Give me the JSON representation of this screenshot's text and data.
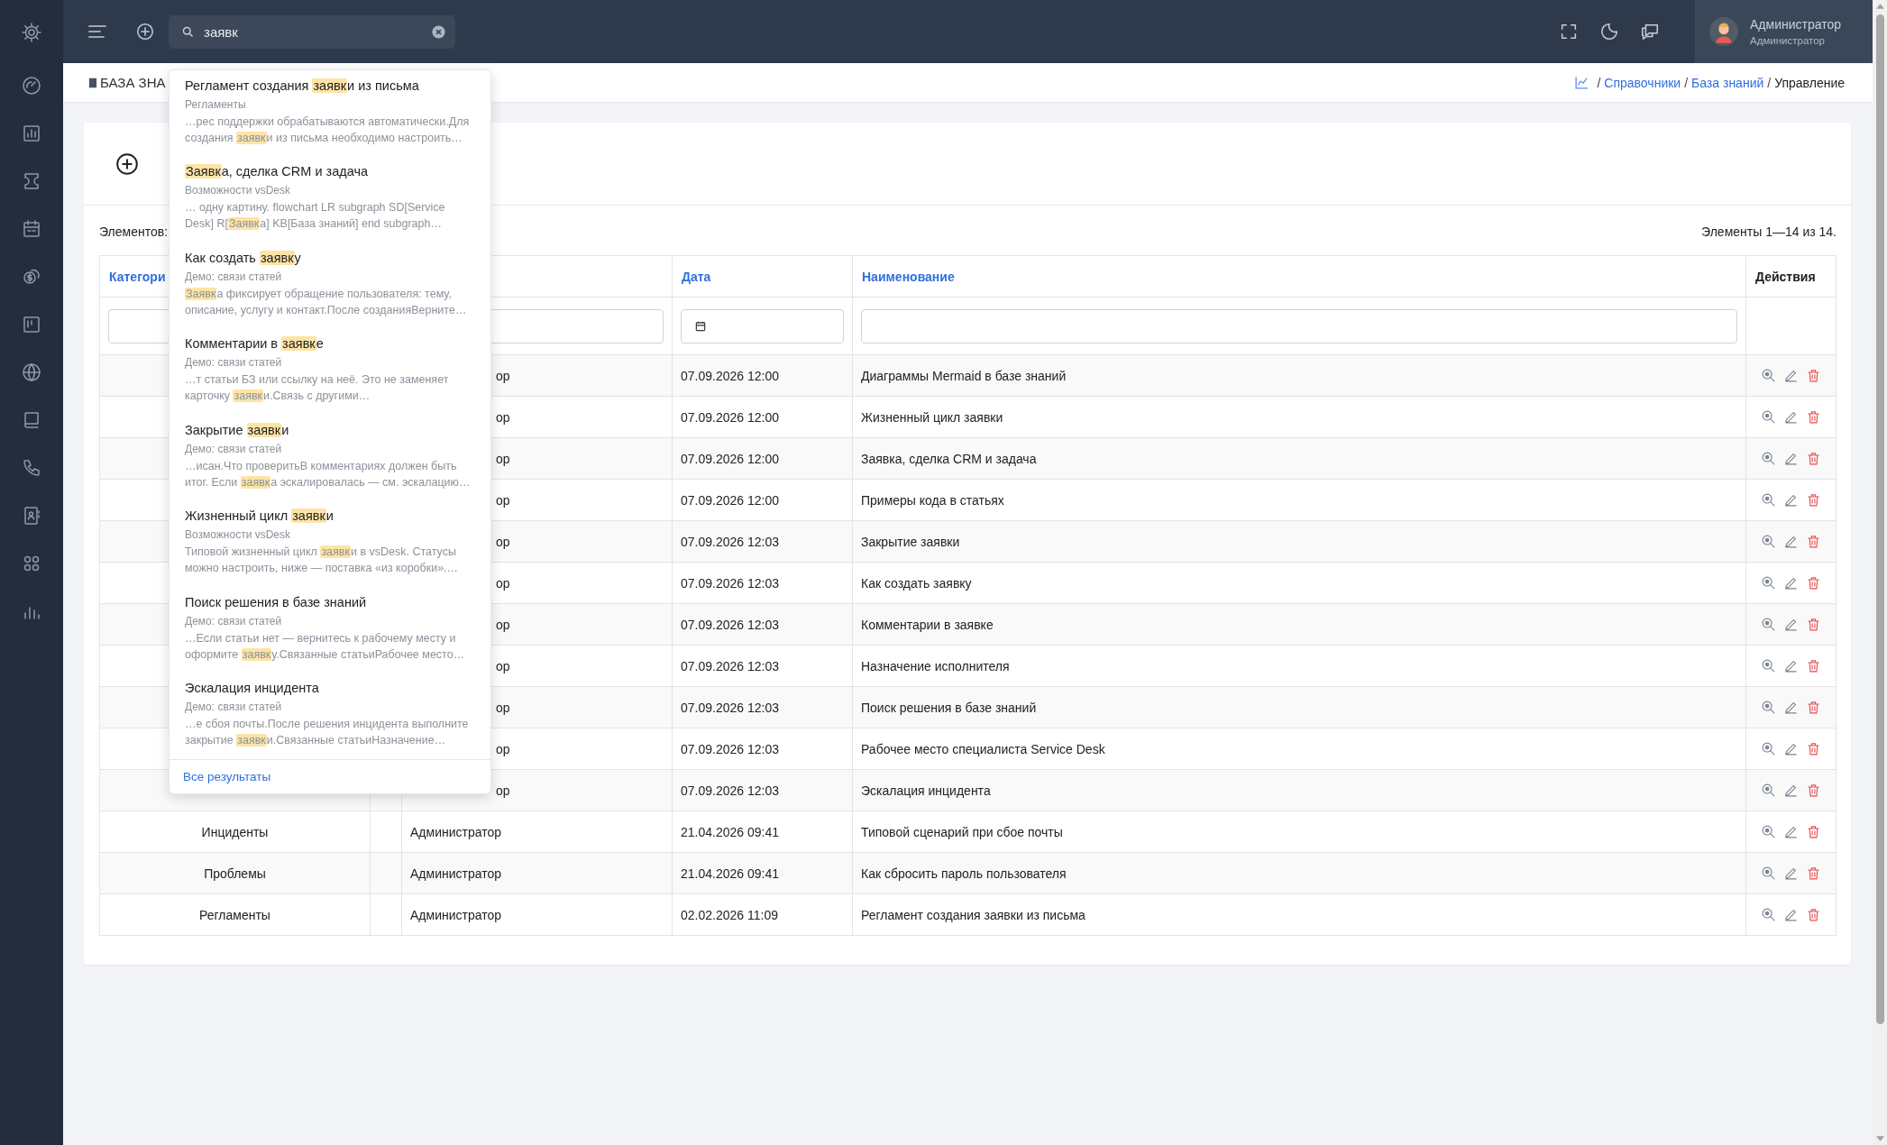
{
  "search": {
    "value": "заявк",
    "results": [
      {
        "title": [
          {
            "text": "Регламент создания ",
            "highlighted": false
          },
          {
            "text": "заявк",
            "highlighted": true
          },
          {
            "text": "и из письма",
            "highlighted": false
          }
        ],
        "category": "Регламенты",
        "snippet": [
          [
            {
              "text": "…рес поддержки обрабатываются автоматически.Для",
              "highlighted": false
            }
          ],
          [
            {
              "text": "создания ",
              "highlighted": false
            },
            {
              "text": "заявк",
              "highlighted": true
            },
            {
              "text": "и из письма необходимо настроить…",
              "highlighted": false
            }
          ]
        ]
      },
      {
        "title": [
          {
            "text": "Заявк",
            "highlighted": true
          },
          {
            "text": "а, сделка CRM и задача",
            "highlighted": false
          }
        ],
        "category": "Возможности vsDesk",
        "snippet": [
          [
            {
              "text": "… одну картину. flowchart LR subgraph SD[Service",
              "highlighted": false
            }
          ],
          [
            {
              "text": "Desk] R[",
              "highlighted": false
            },
            {
              "text": "Заявк",
              "highlighted": true
            },
            {
              "text": "а] KB[База знаний] end subgraph…",
              "highlighted": false
            }
          ]
        ]
      },
      {
        "title": [
          {
            "text": "Как создать ",
            "highlighted": false
          },
          {
            "text": "заявк",
            "highlighted": true
          },
          {
            "text": "у",
            "highlighted": false
          }
        ],
        "category": "Демо: связи статей",
        "snippet": [
          [
            {
              "text": "Заявк",
              "highlighted": true
            },
            {
              "text": "а фиксирует обращение пользователя: тему,",
              "highlighted": false
            }
          ],
          [
            {
              "text": "описание, услугу и контакт.После созданияВерните…",
              "highlighted": false
            }
          ]
        ]
      },
      {
        "title": [
          {
            "text": "Комментарии в ",
            "highlighted": false
          },
          {
            "text": "заявк",
            "highlighted": true
          },
          {
            "text": "е",
            "highlighted": false
          }
        ],
        "category": "Демо: связи статей",
        "snippet": [
          [
            {
              "text": "…т статьи БЗ или ссылку на неё. Это не заменяет",
              "highlighted": false
            }
          ],
          [
            {
              "text": "карточку ",
              "highlighted": false
            },
            {
              "text": "заявк",
              "highlighted": true
            },
            {
              "text": "и.Связь с другими…",
              "highlighted": false
            }
          ]
        ]
      },
      {
        "title": [
          {
            "text": "Закрытие ",
            "highlighted": false
          },
          {
            "text": "заявк",
            "highlighted": true
          },
          {
            "text": "и",
            "highlighted": false
          }
        ],
        "category": "Демо: связи статей",
        "snippet": [
          [
            {
              "text": "…исан.Что проверитьВ комментариях должен быть",
              "highlighted": false
            }
          ],
          [
            {
              "text": "итог. Если ",
              "highlighted": false
            },
            {
              "text": "заявк",
              "highlighted": true
            },
            {
              "text": "а эскалировалась — см. эскалацию…",
              "highlighted": false
            }
          ]
        ]
      },
      {
        "title": [
          {
            "text": "Жизненный цикл ",
            "highlighted": false
          },
          {
            "text": "заявк",
            "highlighted": true
          },
          {
            "text": "и",
            "highlighted": false
          }
        ],
        "category": "Возможности vsDesk",
        "snippet": [
          [
            {
              "text": "Типовой жизненный цикл ",
              "highlighted": false
            },
            {
              "text": "заявк",
              "highlighted": true
            },
            {
              "text": "и в vsDesk. Статусы",
              "highlighted": false
            }
          ],
          [
            {
              "text": "можно настроить, ниже — поставка «из коробки».…",
              "highlighted": false
            }
          ]
        ]
      },
      {
        "title": [
          {
            "text": "Поиск решения в базе знаний",
            "highlighted": false
          }
        ],
        "category": "Демо: связи статей",
        "snippet": [
          [
            {
              "text": "…Если статьи нет — вернитесь к рабочему месту и",
              "highlighted": false
            }
          ],
          [
            {
              "text": "оформите ",
              "highlighted": false
            },
            {
              "text": "заявк",
              "highlighted": true
            },
            {
              "text": "у.Связанные статьиРабочее место…",
              "highlighted": false
            }
          ]
        ]
      },
      {
        "title": [
          {
            "text": "Эскалация инцидента",
            "highlighted": false
          }
        ],
        "category": "Демо: связи статей",
        "snippet": [
          [
            {
              "text": "…е сбоя почты.После решения инцидента выполните",
              "highlighted": false
            }
          ],
          [
            {
              "text": "закрытие ",
              "highlighted": false
            },
            {
              "text": "заявк",
              "highlighted": true
            },
            {
              "text": "и.Связанные статьиНазначение…",
              "highlighted": false
            }
          ]
        ]
      }
    ],
    "all_results": "Все результаты"
  },
  "user": {
    "name": "Администратор",
    "role": "Администратор"
  },
  "page_title": "БАЗА ЗНА",
  "breadcrumbs": {
    "separator": "/",
    "items": [
      {
        "label": "Справочники",
        "kind": "link"
      },
      {
        "label": "База знаний",
        "kind": "link"
      },
      {
        "label": "Управление",
        "kind": "current"
      }
    ]
  },
  "table": {
    "page_size_label": "Элементов:",
    "summary": "Элементы 1—14 из 14.",
    "columns": [
      {
        "label": "Категори",
        "kind": "sortable"
      },
      {
        "kind": "blank"
      },
      {
        "kind": "filter"
      },
      {
        "label": "Дата",
        "kind": "date"
      },
      {
        "label": "Наименование",
        "kind": "sortable"
      },
      {
        "label": "Действия",
        "kind": "plain"
      }
    ],
    "rows": [
      {
        "kind": "covered",
        "author": "ор",
        "date": "07.09.2026 12:00",
        "name": "Диаграммы Mermaid в базе знаний"
      },
      {
        "kind": "covered",
        "author": "ор",
        "date": "07.09.2026 12:00",
        "name": "Жизненный цикл заявки"
      },
      {
        "kind": "covered",
        "author": "ор",
        "date": "07.09.2026 12:00",
        "name": "Заявка, сделка CRM и задача"
      },
      {
        "kind": "covered",
        "author": "ор",
        "date": "07.09.2026 12:00",
        "name": "Примеры кода в статьях"
      },
      {
        "kind": "covered",
        "author": "ор",
        "date": "07.09.2026 12:03",
        "name": "Закрытие заявки"
      },
      {
        "kind": "covered",
        "author": "ор",
        "date": "07.09.2026 12:03",
        "name": "Как создать заявку"
      },
      {
        "kind": "covered",
        "author": "ор",
        "date": "07.09.2026 12:03",
        "name": "Комментарии в заявке"
      },
      {
        "kind": "covered",
        "author": "ор",
        "date": "07.09.2026 12:03",
        "name": "Назначение исполнителя"
      },
      {
        "kind": "covered",
        "author": "ор",
        "date": "07.09.2026 12:03",
        "name": "Поиск решения в базе знаний"
      },
      {
        "kind": "covered",
        "author": "ор",
        "date": "07.09.2026 12:03",
        "name": "Рабочее место специалиста Service Desk"
      },
      {
        "kind": "covered",
        "author": "ор",
        "date": "07.09.2026 12:03",
        "name": "Эскалация инцидента"
      },
      {
        "kind": "plain",
        "category": "Инциденты",
        "author": "Администратор",
        "date": "21.04.2026 09:41",
        "name": "Типовой сценарий при сбое почты"
      },
      {
        "kind": "plain",
        "category": "Проблемы",
        "author": "Администратор",
        "date": "21.04.2026 09:41",
        "name": "Как сбросить пароль пользователя"
      },
      {
        "kind": "plain",
        "category": "Регламенты",
        "author": "Администратор",
        "date": "02.02.2026 11:09",
        "name": "Регламент создания заявки из письма"
      }
    ]
  }
}
